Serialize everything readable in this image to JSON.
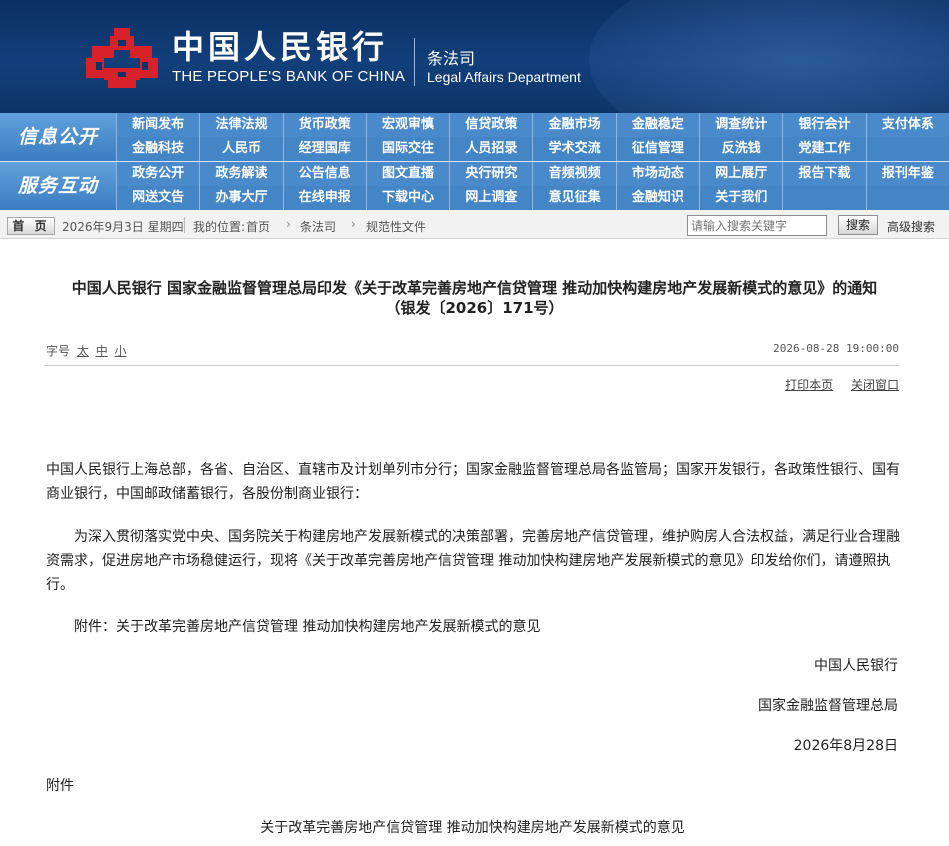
{
  "header": {
    "org_cn": "中国人民银行",
    "org_en": "THE PEOPLE'S BANK OF CHINA",
    "dept_cn": "条法司",
    "dept_en": "Legal Affairs Department",
    "logo_color": "#d7222a",
    "banner_color": "#0d3468"
  },
  "nav": {
    "categories": [
      "信息公开",
      "服务互动"
    ],
    "row1": [
      "新闻发布",
      "法律法规",
      "货币政策",
      "宏观审慎",
      "信贷政策",
      "金融市场",
      "金融稳定",
      "调查统计",
      "银行会计",
      "支付体系"
    ],
    "row2": [
      "金融科技",
      "人民币",
      "经理国库",
      "国际交往",
      "人员招录",
      "学术交流",
      "征信管理",
      "反洗钱",
      "党建工作",
      ""
    ],
    "row3": [
      "政务公开",
      "政务解读",
      "公告信息",
      "图文直播",
      "央行研究",
      "音频视频",
      "市场动态",
      "网上展厅",
      "报告下载",
      "报刊年鉴"
    ],
    "row4": [
      "网送文告",
      "办事大厅",
      "在线申报",
      "下载中心",
      "网上调查",
      "意见征集",
      "金融知识",
      "关于我们",
      "",
      ""
    ]
  },
  "breadcrumb": {
    "home_label": "首 页",
    "date": "2026年9月3日 星期四",
    "location_label": "我的位置:",
    "items": [
      "首页",
      "条法司",
      "规范性文件"
    ],
    "search_placeholder": "请输入搜索关键字",
    "search_button": "搜索",
    "advanced_search": "高级搜索"
  },
  "article": {
    "title_line1": "中国人民银行 国家金融监督管理总局印发《关于改革完善房地产信贷管理 推动加快构建房地产发展新模式的意见》的通知",
    "title_line2": "（银发〔2026〕171号）",
    "font_size_label": "字号",
    "font_sizes": [
      "太",
      "中",
      "小"
    ],
    "publish_time": "2026-08-28 19:00:00",
    "print_label": "打印本页",
    "close_label": "关闭窗口",
    "addressees": "中国人民银行上海总部，各省、自治区、直辖市及计划单列市分行；国家金融监督管理总局各监管局；国家开发银行，各政策性银行、国有商业银行，中国邮政储蓄银行，各股份制商业银行：",
    "main_paragraph": "为深入贯彻落实党中央、国务院关于构建房地产发展新模式的决策部署，完善房地产信贷管理，维护购房人合法权益，满足行业合理融资需求，促进房地产市场稳健运行，现将《关于改革完善房地产信贷管理 推动加快构建房地产发展新模式的意见》印发给你们，请遵照执行。",
    "attachment_line": "附件：关于改革完善房地产信贷管理 推动加快构建房地产发展新模式的意见",
    "signature_1": "中国人民银行",
    "signature_2": "国家金融监督管理总局",
    "signature_date": "2026年8月28日",
    "annex_label": "附件",
    "annex_title": "关于改革完善房地产信贷管理 推动加快构建房地产发展新模式的意见"
  }
}
